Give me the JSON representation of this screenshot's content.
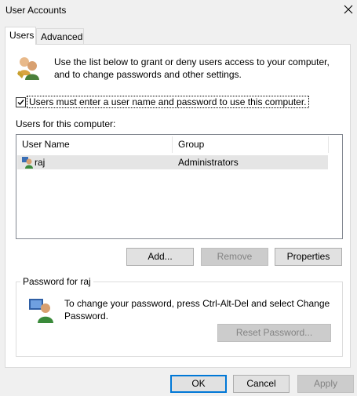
{
  "window": {
    "title": "User Accounts"
  },
  "tabs": [
    {
      "label": "Users",
      "active": true
    },
    {
      "label": "Advanced",
      "active": false
    }
  ],
  "intro": {
    "text": "Use the list below to grant or deny users access to your computer, and to change passwords and other settings."
  },
  "require_login": {
    "checked": true,
    "label": "Users must enter a user name and password to use this computer."
  },
  "users_list": {
    "label": "Users for this computer:",
    "columns": [
      "User Name",
      "Group"
    ],
    "rows": [
      {
        "name": "raj",
        "group": "Administrators",
        "selected": true
      }
    ]
  },
  "list_buttons": {
    "add": "Add...",
    "remove": "Remove",
    "properties": "Properties"
  },
  "password_group": {
    "title": "Password for raj",
    "text": "To change your password, press Ctrl-Alt-Del and select Change Password.",
    "reset_button": "Reset Password..."
  },
  "dialog_buttons": {
    "ok": "OK",
    "cancel": "Cancel",
    "apply": "Apply"
  },
  "icons": [
    "users-icon",
    "user-icon",
    "user-password-icon",
    "close-icon",
    "checkmark-icon"
  ]
}
